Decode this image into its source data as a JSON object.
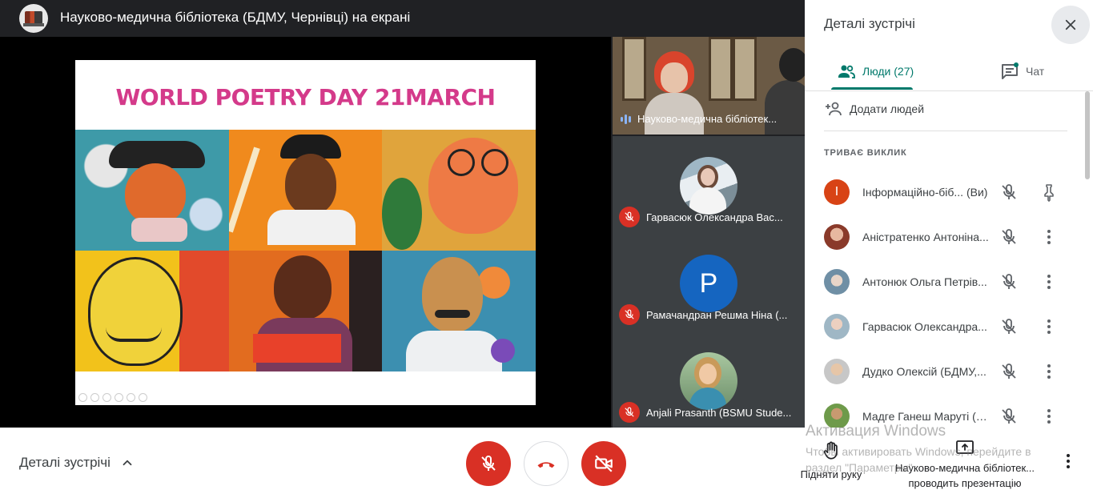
{
  "header": {
    "title": "Науково-медична бібліотека (БДМУ, Чернівці) на екрані"
  },
  "slide": {
    "title": "WORLD POETRY DAY 21MARCH"
  },
  "strip": {
    "feed_label": "Науково-медична бібліотек...",
    "tiles": [
      {
        "label": "Гарвасюк Олександра Вас..."
      },
      {
        "label": "Рамачандран Решма Ніна (...",
        "initial": "P"
      },
      {
        "label": "Anjali Prasanth (BSMU Stude..."
      }
    ]
  },
  "panel": {
    "title": "Деталі зустрічі",
    "tabs": [
      {
        "label": "Люди (27)"
      },
      {
        "label": "Чат"
      }
    ],
    "add_people": "Додати людей",
    "section_label": "ТРИВАЄ ВИКЛИК",
    "participants": [
      {
        "name": "Інформаційно-біб...",
        "suffix": "(Ви)",
        "initial": "І"
      },
      {
        "name": "Аністратенко Антоніна..."
      },
      {
        "name": "Антонюк Ольга Петрів..."
      },
      {
        "name": "Гарвасюк Олександра..."
      },
      {
        "name": "Дудко Олексій (БДМУ,..."
      },
      {
        "name": "Мадге Ганеш Маруті (В..."
      }
    ]
  },
  "bottom": {
    "details_label": "Деталі зустрічі",
    "raise_hand": "Підняти руку",
    "presenting_line1": "Науково-медична бібліотек...",
    "presenting_line2": "проводить презентацію"
  },
  "watermark": {
    "line1": "Активация Windows",
    "line2": "Чтобы активировать Windows, перейдите в раздел \"Параметры\"."
  },
  "colors": {
    "accent": "#00796b",
    "danger": "#d93025",
    "slide_title": "#d43a8a"
  }
}
